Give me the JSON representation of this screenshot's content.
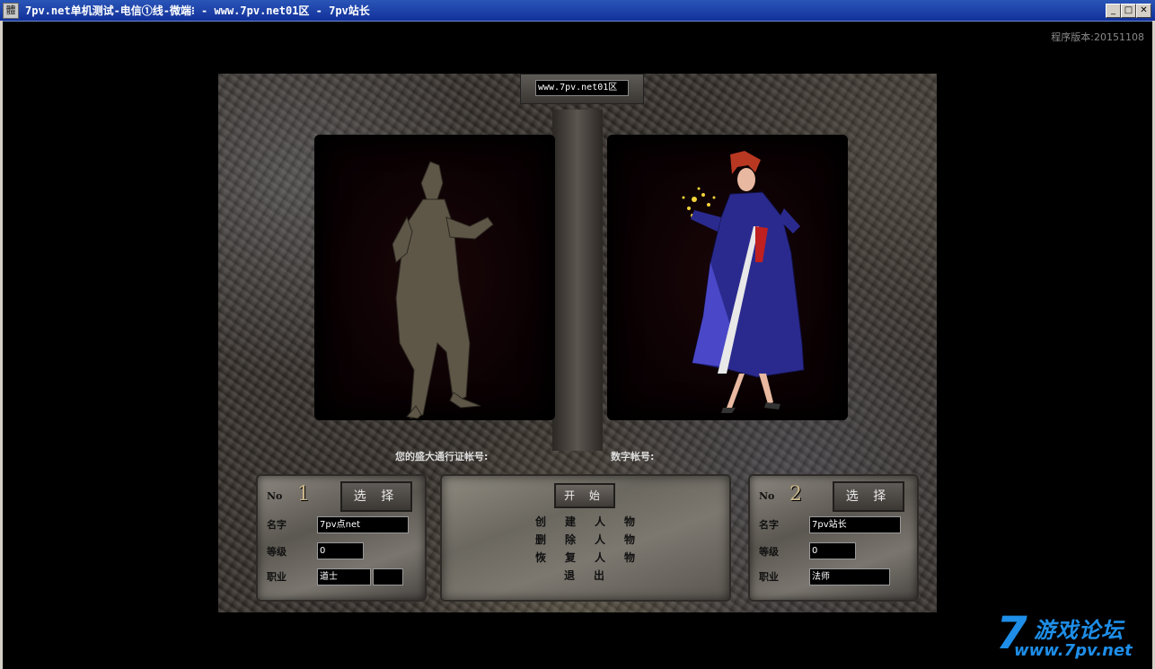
{
  "window": {
    "icon_glyph": "體",
    "title": "7pv.net单机测试-电信①线-微端⁝ - www.7pv.net01区 - 7pv站长",
    "minimize_glyph": "_",
    "maximize_glyph": "□",
    "close_glyph": "✕"
  },
  "version_text": "程序版本:20151108",
  "server_name": "www.7pv.net01区",
  "account": {
    "shanda_label": "您的盛大通行证帐号:",
    "digital_label": "数字帐号:"
  },
  "slots": [
    {
      "no_label": "No",
      "number": "1",
      "select_label": "选 择",
      "name_label": "名字",
      "name_value": "7pv点net",
      "level_label": "等级",
      "level_value": "0",
      "job_label": "职业",
      "job_value": "道士"
    },
    {
      "no_label": "No",
      "number": "2",
      "select_label": "选 择",
      "name_label": "名字",
      "name_value": "7pv站长",
      "level_label": "等级",
      "level_value": "0",
      "job_label": "职业",
      "job_value": "法师"
    }
  ],
  "menu": {
    "start": "开 始",
    "create": "创建人物",
    "delete": "删除人物",
    "restore": "恢复人物",
    "exit": "退出"
  },
  "watermark": {
    "seven": "7",
    "title": "游戏论坛",
    "url": "www.7pv.net"
  },
  "colors": {
    "titlebar": "#1a3ea8",
    "watermark": "#1e8ee8"
  }
}
